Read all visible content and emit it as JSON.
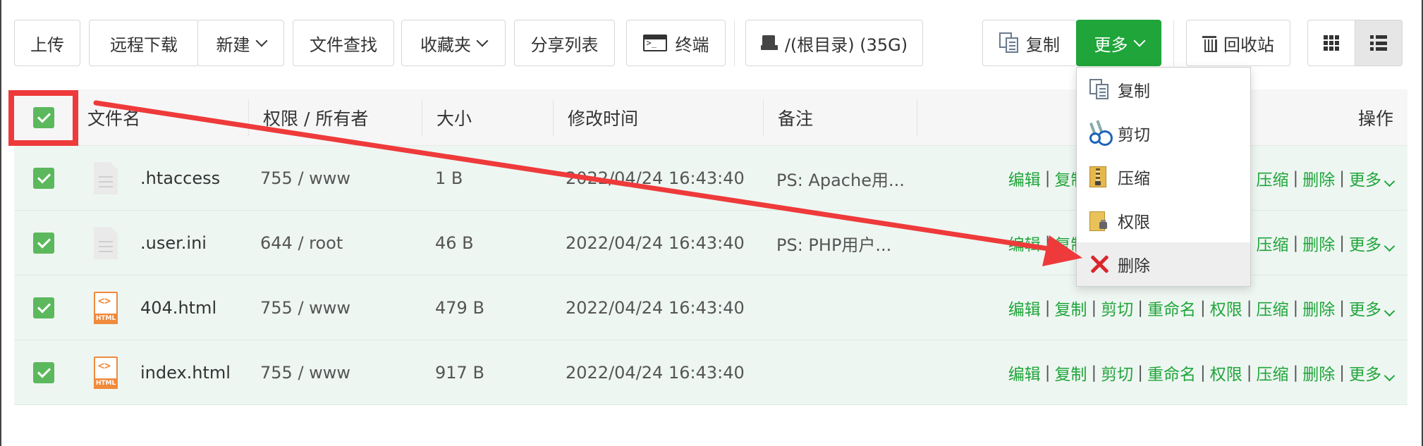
{
  "toolbar": {
    "upload": "上传",
    "remote_download": "远程下载",
    "new": "新建",
    "file_search": "文件查找",
    "favorites": "收藏夹",
    "share_list": "分享列表",
    "terminal": "终端",
    "disk": "/(根目录) (35G)",
    "copy": "复制",
    "more": "更多",
    "recycle_bin": "回收站"
  },
  "table": {
    "headers": {
      "name": "文件名",
      "perm_owner": "权限 / 所有者",
      "size": "大小",
      "modified": "修改时间",
      "remark": "备注",
      "actions": "操作"
    },
    "rows": [
      {
        "name": ".htaccess",
        "perm": "755 / www",
        "size": "1 B",
        "time": "2022/04/24 16:43:40",
        "remark": "PS: Apache用...",
        "icon": "text-file-icon"
      },
      {
        "name": ".user.ini",
        "perm": "644 / root",
        "size": "46 B",
        "time": "2022/04/24 16:43:40",
        "remark": "PS: PHP用户...",
        "icon": "text-file-icon"
      },
      {
        "name": "404.html",
        "perm": "755 / www",
        "size": "479 B",
        "time": "2022/04/24 16:43:40",
        "remark": "",
        "icon": "html-file-icon"
      },
      {
        "name": "index.html",
        "perm": "755 / www",
        "size": "917 B",
        "time": "2022/04/24 16:43:40",
        "remark": "",
        "icon": "html-file-icon"
      }
    ],
    "row_actions": {
      "edit": "编辑",
      "copy": "复制",
      "cut": "剪切",
      "rename": "重命名",
      "perm": "权限",
      "compress": "压缩",
      "delete": "删除",
      "more": "更多",
      "separator": "|"
    }
  },
  "dropdown": {
    "items": [
      {
        "label": "复制",
        "icon": "copy-icon"
      },
      {
        "label": "剪切",
        "icon": "scissors-icon"
      },
      {
        "label": "压缩",
        "icon": "zip-icon"
      },
      {
        "label": "权限",
        "icon": "permission-icon"
      },
      {
        "label": "删除",
        "icon": "delete-icon"
      }
    ]
  },
  "colors": {
    "accent_green": "#20a53a",
    "checkbox_green": "#5cb85c",
    "annotation_red": "#ee3a3a",
    "row_bg": "#eef6f2"
  }
}
